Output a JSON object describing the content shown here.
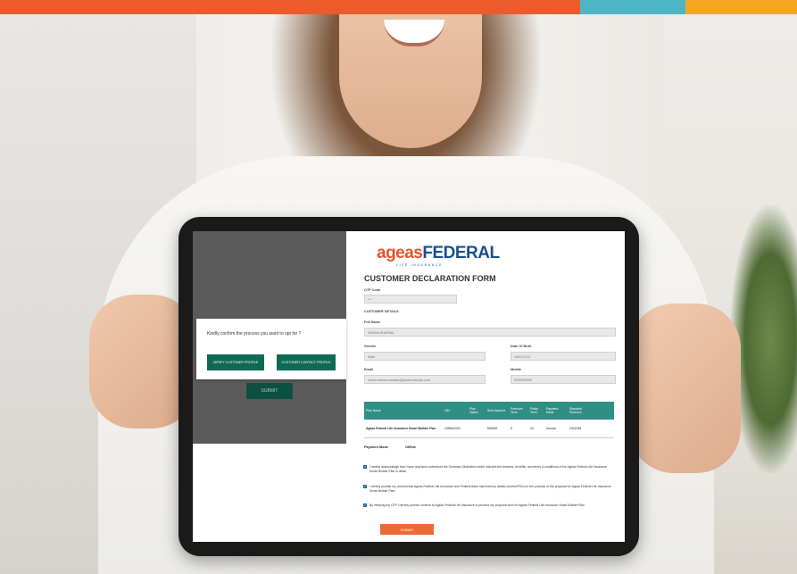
{
  "stripe_colors": [
    "#ec5b2c",
    "#ec5b2c",
    "#4cb6c7",
    "#f6a623"
  ],
  "modal": {
    "question": "Kindly confirm the process you want to opt for ?",
    "btn_left": "VERIFY CUSTOMER PROFILE",
    "btn_right": "CUSTOMER CONTACT PROFILE",
    "ghost_button": "SUBMIT"
  },
  "brand": {
    "name_left": "ageas",
    "name_right": "FEDERAL",
    "tagline": "LIFE INSURANCE"
  },
  "form": {
    "title": "CUSTOMER DECLARATION FORM",
    "otp_label": "OTP Code",
    "otp_value": "***",
    "section_label": "CUSTOMER DETAILS",
    "fullname_label": "Full Name",
    "fullname_value": "RAVINA SHARMA",
    "gender_label": "Gender",
    "gender_value": "Male",
    "dob_label": "Date Of Birth",
    "dob_value": "1992-01-01",
    "email_label": "Email",
    "email_value": "ravina.sharma.sample@gmail.example.com",
    "mobile_label": "Mobile",
    "mobile_value": "9999999999"
  },
  "table": {
    "headers": [
      "Plan Name",
      "UIN",
      "Plan Option",
      "Sum Assured",
      "Premium Term",
      "Policy Term",
      "Payment Mode",
      "Standard Premium"
    ],
    "rows": [
      [
        "Ageas Federal Life Insurance Smart Builder Plan",
        "135N02V02",
        "",
        "800000",
        "5",
        "15",
        "Annual",
        "2401338"
      ]
    ]
  },
  "payment_mode_label": "Payment Mode",
  "payment_mode_value": "Offline",
  "declarations": [
    "I hereby acknowledge that I have read and understood the Summary Illustration which includes the features, benefits, and terms & conditions of the Ageas Federal Life Insurance Smart Builder Plan in detail.",
    "I hereby provide my consent that Ageas Federal Life Insurance and Federal Bank has fixed my details (Author/PSA) for the purpose of the proposal for Ageas Federal Life Insurance Smart Builder Plan.",
    "By verifying my OTP I hereby provide consent to Ageas Federal Life Insurance to process my proposal form for Ageas Federal Life Insurance Smart Builder Plan."
  ],
  "submit_label": "SUBMIT"
}
